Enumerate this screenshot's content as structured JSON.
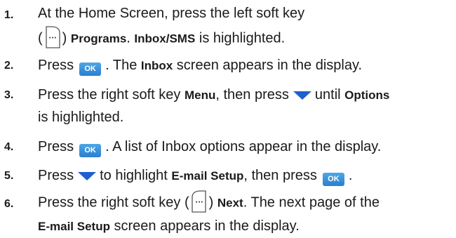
{
  "steps": [
    {
      "number": "1.",
      "line1": {
        "t1": "At the Home Screen, press the left soft key"
      },
      "line2": {
        "open": "(",
        "close": ")",
        "b1": "Programs",
        "t1": ". ",
        "b2": "Inbox/SMS",
        "t2": " is highlighted."
      }
    },
    {
      "number": "2.",
      "line1": {
        "t1": "Press",
        "ok": "OK",
        "t2": ". The ",
        "b1": "Inbox",
        "t3": " screen appears in the display."
      }
    },
    {
      "number": "3.",
      "line1": {
        "t1": "Press the right soft key ",
        "b1": "Menu",
        "t2": ", then press",
        "t3": "until ",
        "b2": "Options"
      },
      "line2": {
        "t1": "is highlighted."
      }
    },
    {
      "number": "4.",
      "line1": {
        "t1": "Press",
        "ok": "OK",
        "t2": ". A list of Inbox options appear in the display."
      }
    },
    {
      "number": "5.",
      "line1": {
        "t1": "Press",
        "t2": "to highlight ",
        "b1": "E-mail Setup",
        "t3": ", then press",
        "ok": "OK",
        "t4": "."
      }
    },
    {
      "number": "6.",
      "line1": {
        "t1": "Press the right soft key (",
        "t2": ") ",
        "b1": "Next",
        "t3": ". The next page of the"
      },
      "line2": {
        "b1": "E-mail Setup",
        "t1": " screen appears in the display."
      }
    }
  ],
  "icons": {
    "left_soft_key": "left-soft-key-icon",
    "right_soft_key": "right-soft-key-icon",
    "ok_key": "ok-key-icon",
    "navigation_down": "down-arrow-icon"
  },
  "colors": {
    "ok_key": "#2a7fcf",
    "down_arrow": "#1f5fd0",
    "text": "#1a1a1a"
  }
}
